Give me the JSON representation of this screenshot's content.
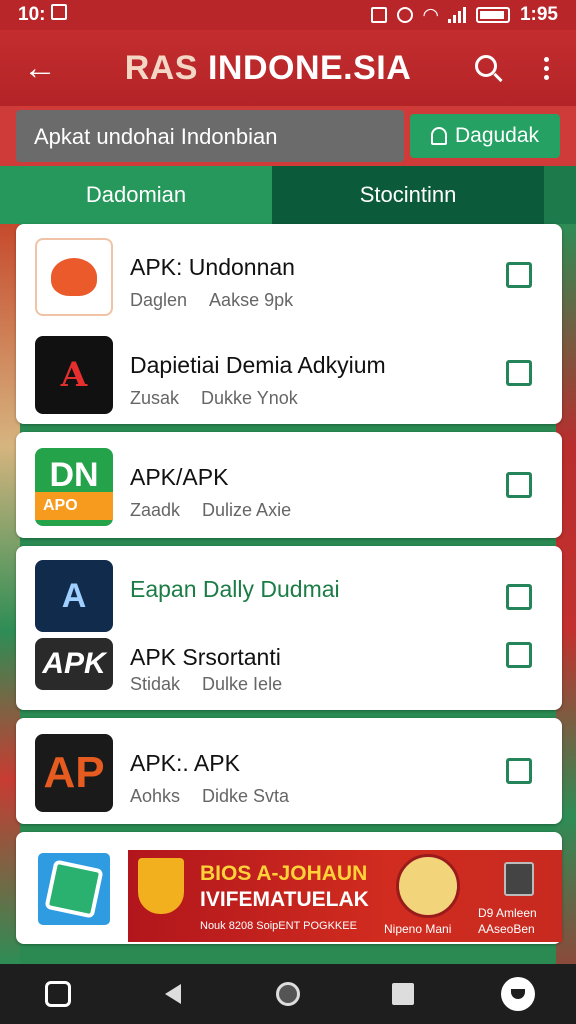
{
  "status_bar": {
    "time": "10:",
    "time_icon": "screenshot-icon",
    "right_time": "1:95",
    "icons": [
      "nfc-icon",
      "vibrate-icon",
      "wifi-icon",
      "signal-icon",
      "battery-icon"
    ]
  },
  "app_bar": {
    "title_left": "RAS",
    "title_right": "INDONE.SIA",
    "back_icon": "arrow-left-icon",
    "search_icon": "search-icon",
    "more_icon": "more-vert-icon",
    "color": "#b8262a"
  },
  "search": {
    "text": "Apkat undohai Indonbian",
    "download_label": "Dagudak",
    "download_color": "#24a163"
  },
  "tabs": [
    {
      "label": "Dadomian",
      "active": true
    },
    {
      "label": "Stocintinn",
      "active": false
    }
  ],
  "apps": [
    {
      "title": "APK: Undonnan",
      "meta1": "Daglen",
      "meta2": "Aakse 9pk"
    },
    {
      "title": "Dapietiai Demia Adkyium",
      "meta1": "Zusak",
      "meta2": "Dukke Ynok",
      "icon_text": "A"
    },
    {
      "title": "APK/APK",
      "meta1": "Zaadk",
      "meta2": "Dulize Axie",
      "icon_top": "DN",
      "icon_bar": "APO"
    },
    {
      "title": "Eapan Dally Dudmai",
      "icon_text": "A"
    },
    {
      "title": "APK Srsortanti",
      "meta1": "Stidak",
      "meta2": "Dulke Iele",
      "icon_text": "APK"
    },
    {
      "title": "APK:. APK",
      "meta1": "Aohks",
      "meta2": "Didke Svta",
      "icon_text": "AP"
    }
  ],
  "banner": {
    "line1": "BIOS A-JOHAUN",
    "line2": "IVIFEMATUELAK",
    "line3": "Nouk 8208 SoipENT POGKKEE",
    "seal_caption": "Nipeno Mani",
    "right_line1": "D9 Amleen",
    "right_line2": "AAseoBen"
  },
  "nav_bar": {
    "icons": [
      "home-square-icon",
      "back-icon",
      "home-circle-icon",
      "recents-icon",
      "profile-icon"
    ]
  }
}
